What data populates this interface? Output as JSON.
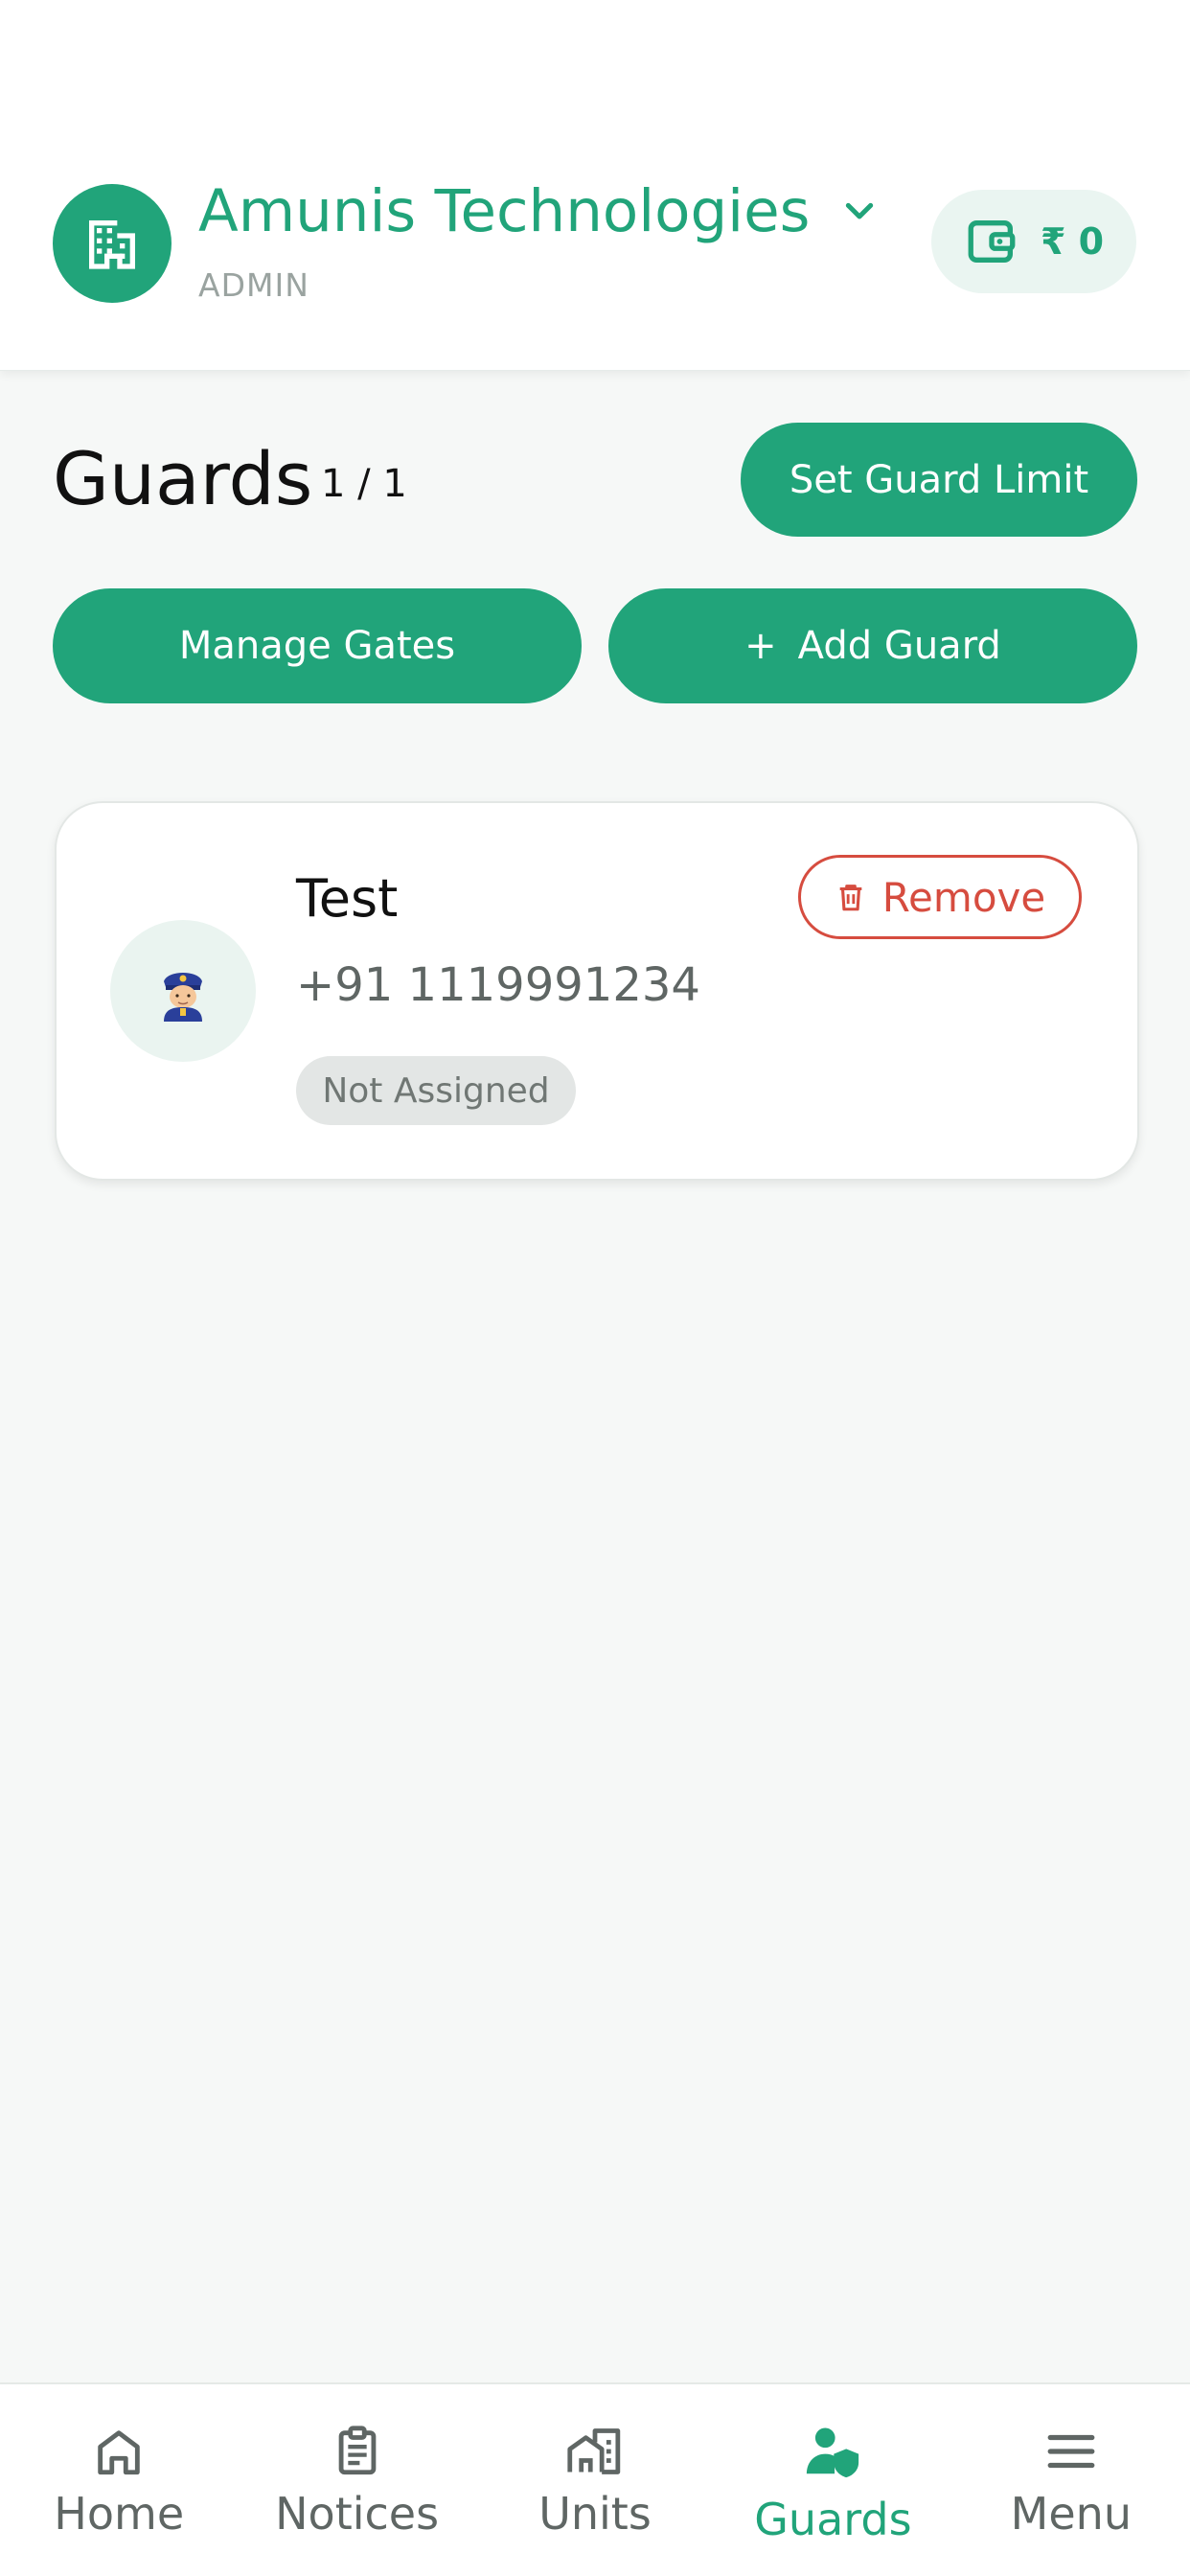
{
  "colors": {
    "accent": "#21a47a",
    "danger": "#d64c3f",
    "muted": "#5f6664",
    "badge_bg": "#e3e6e5"
  },
  "header": {
    "org_name": "Amunis Technologies",
    "org_role": "ADMIN",
    "org_icon": "building-icon",
    "wallet_icon": "wallet-icon",
    "wallet_amount": "₹ 0"
  },
  "page": {
    "title": "Guards",
    "count": "1 / 1",
    "set_limit_label": "Set Guard Limit",
    "manage_gates_label": "Manage Gates",
    "add_guard_plus": "+",
    "add_guard_label": "Add Guard"
  },
  "guards": [
    {
      "name": "Test",
      "phone": "+91 1119991234",
      "status": "Not Assigned",
      "avatar_icon": "police-officer-icon",
      "remove_label": "Remove"
    }
  ],
  "nav": {
    "active": "guards",
    "items": [
      {
        "id": "home",
        "label": "Home",
        "icon": "home-icon"
      },
      {
        "id": "notices",
        "label": "Notices",
        "icon": "clipboard-icon"
      },
      {
        "id": "units",
        "label": "Units",
        "icon": "building-units-icon"
      },
      {
        "id": "guards",
        "label": "Guards",
        "icon": "guard-shield-icon"
      },
      {
        "id": "menu",
        "label": "Menu",
        "icon": "hamburger-icon"
      }
    ]
  }
}
